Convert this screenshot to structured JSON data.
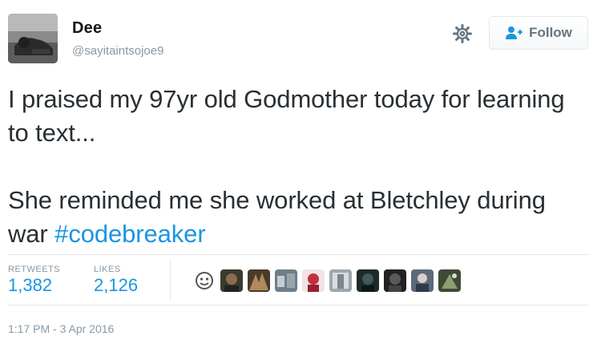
{
  "user": {
    "name": "Dee",
    "handle": "@sayitaintsojoe9"
  },
  "actions": {
    "follow_label": "Follow",
    "settings_icon": "gear-icon",
    "follow_icon": "add-user-icon"
  },
  "tweet": {
    "line1": "I praised my 97yr old Godmother today for learning to text...",
    "line2_prefix": "She reminded me she worked at Bletchley during war ",
    "hashtag": "#codebreaker"
  },
  "stats": {
    "retweets_label": "RETWEETS",
    "retweets_value": "1,382",
    "likes_label": "LIKES",
    "likes_value": "2,126"
  },
  "likers_count_shown": 10,
  "timestamp": "1:17 PM - 3 Apr 2016",
  "colors": {
    "link": "#1b95e0",
    "muted": "#8899a6",
    "text": "#292f33"
  }
}
